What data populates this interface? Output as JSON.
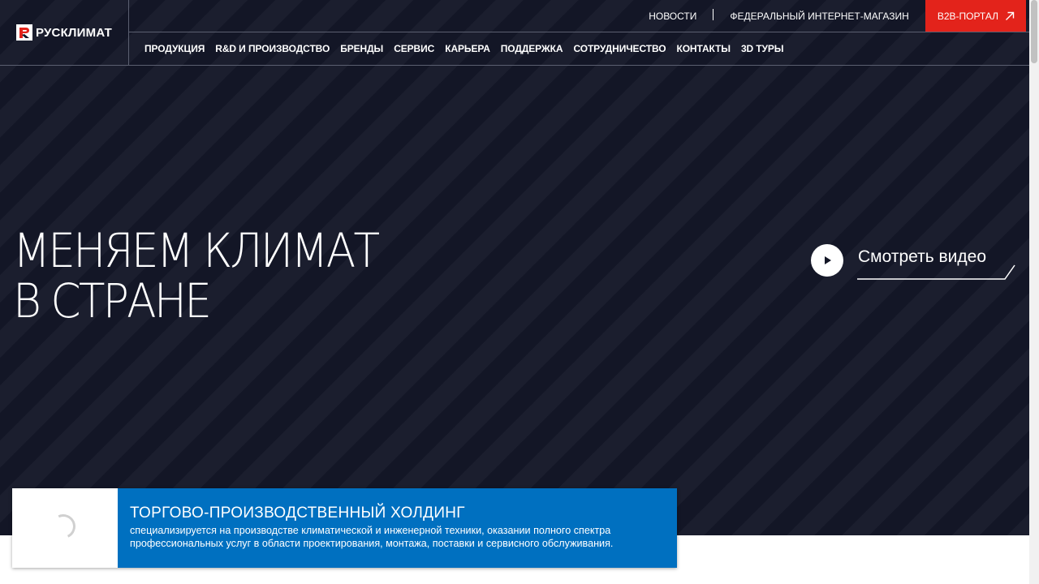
{
  "brand": {
    "name": "РУСКЛИМАТ",
    "accent": "#e3231b"
  },
  "header": {
    "top_links": [
      {
        "label": "НОВОСТИ"
      },
      {
        "label": "ФЕДЕРАЛЬНЫЙ ИНТЕРНЕТ-МАГАЗИН"
      }
    ],
    "b2b": {
      "label": "B2B-ПОРТАЛ",
      "icon": "arrow-up-right-icon"
    },
    "nav": [
      {
        "label": "ПРОДУКЦИЯ"
      },
      {
        "label": "R&D И ПРОИЗВОДСТВО"
      },
      {
        "label": "БРЕНДЫ"
      },
      {
        "label": "СЕРВИС"
      },
      {
        "label": "КАРЬЕРА"
      },
      {
        "label": "ПОДДЕРЖКА"
      },
      {
        "label": "СОТРУДНИЧЕСТВО"
      },
      {
        "label": "КОНТАКТЫ"
      },
      {
        "label": "3D ТУРЫ"
      }
    ]
  },
  "hero": {
    "title_line1": "МЕНЯЕМ КЛИМАТ",
    "title_line2": "В СТРАНЕ",
    "video_label": "Смотреть видео",
    "background": "#131626"
  },
  "card": {
    "title": "ТОРГОВО-ПРОИЗВОДСТВЕННЫЙ ХОЛДИНГ",
    "description": "специализируется на производстве климатической и инженерной техники, оказании полного спектра профессиональных услуг в области проектирования, монтажа, поставки и сервисного обслуживания.",
    "color": "#0070c0"
  }
}
